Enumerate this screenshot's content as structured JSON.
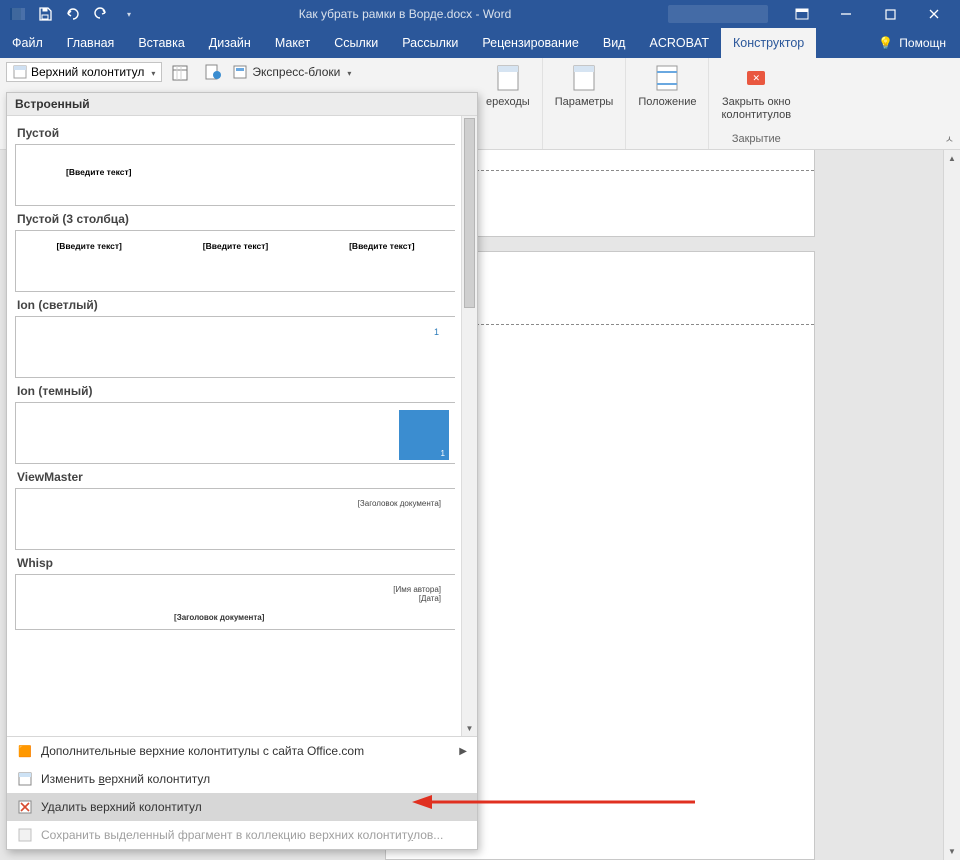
{
  "title": "Как убрать рамки в Ворде.docx - Word",
  "qat": {
    "save": "save-icon",
    "undo": "undo-icon",
    "redo": "redo-icon"
  },
  "win": {
    "opts": "⧉",
    "min": "—",
    "max": "☐",
    "close": "✕"
  },
  "menu": {
    "items": [
      "Файл",
      "Главная",
      "Вставка",
      "Дизайн",
      "Макет",
      "Ссылки",
      "Рассылки",
      "Рецензирование",
      "Вид",
      "ACROBAT",
      "Конструктор"
    ],
    "active": "Конструктор",
    "help": "Помощн"
  },
  "ribbon": {
    "header_dropdown": "Верхний колонтитул",
    "express": "Экспресс-блоки",
    "groups": {
      "transitions": "ереходы",
      "params": "Параметры",
      "position": "Положение",
      "close": "Закрыть окно",
      "close2": "колонтитулов",
      "close_section": "Закрытие"
    }
  },
  "gallery": {
    "section": "Встроенный",
    "items": [
      {
        "title": "Пустой",
        "type": "single",
        "ph": "[Введите текст]"
      },
      {
        "title": "Пустой (3 столбца)",
        "type": "threecol",
        "ph": "[Введите текст]"
      },
      {
        "title": "Ion (светлый)",
        "type": "ion-light",
        "num": "1"
      },
      {
        "title": "Ion (темный)",
        "type": "ion-dark",
        "num": "1"
      },
      {
        "title": "ViewMaster",
        "type": "vm",
        "ph": "[Заголовок документа]"
      },
      {
        "title": "Whisp",
        "type": "whisp",
        "author": "[Имя автора]",
        "date": "[Дата]",
        "doc": "[Заголовок документа]"
      }
    ],
    "commands": {
      "more": "Дополнительные верхние колонтитулы с сайта Office.com",
      "edit_pre": "Изменить ",
      "edit_u": "в",
      "edit_post": "ерхний колонтитул",
      "remove": "Удалить верхний колонтитул",
      "save_pre": "Сохранить выделенный фрагмент в коллекцию верхних колонтит",
      "save_u": "у",
      "save_post": "лов..."
    }
  }
}
